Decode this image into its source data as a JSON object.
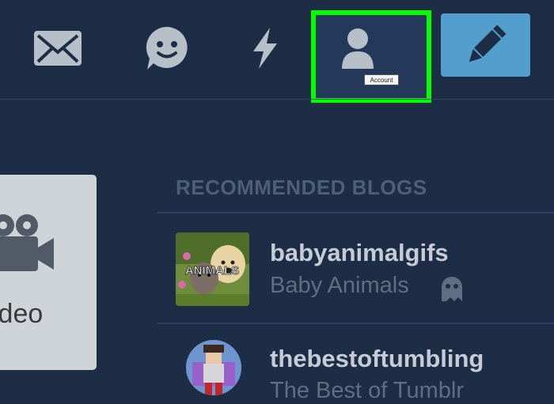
{
  "nav": {
    "account_tooltip": "Account"
  },
  "icons": {
    "mail": "mail-icon",
    "messaging": "smiley-icon",
    "activity": "lightning-icon",
    "account": "user-icon",
    "compose": "pencil-icon",
    "video": "video-camera-icon"
  },
  "colors": {
    "background": "#1d2d45",
    "accent": "#529ecc",
    "highlight": "#00ff00",
    "icon": "#b7bfc9"
  },
  "video_card": {
    "label": "ideo"
  },
  "recommended": {
    "header": "RECOMMENDED BLOGS",
    "blogs": [
      {
        "name": "babyanimalgifs",
        "title": "Baby Animals",
        "avatar_text": "ANIMALS"
      },
      {
        "name": "thebestoftumbling",
        "title": "The Best of Tumblr"
      }
    ]
  }
}
